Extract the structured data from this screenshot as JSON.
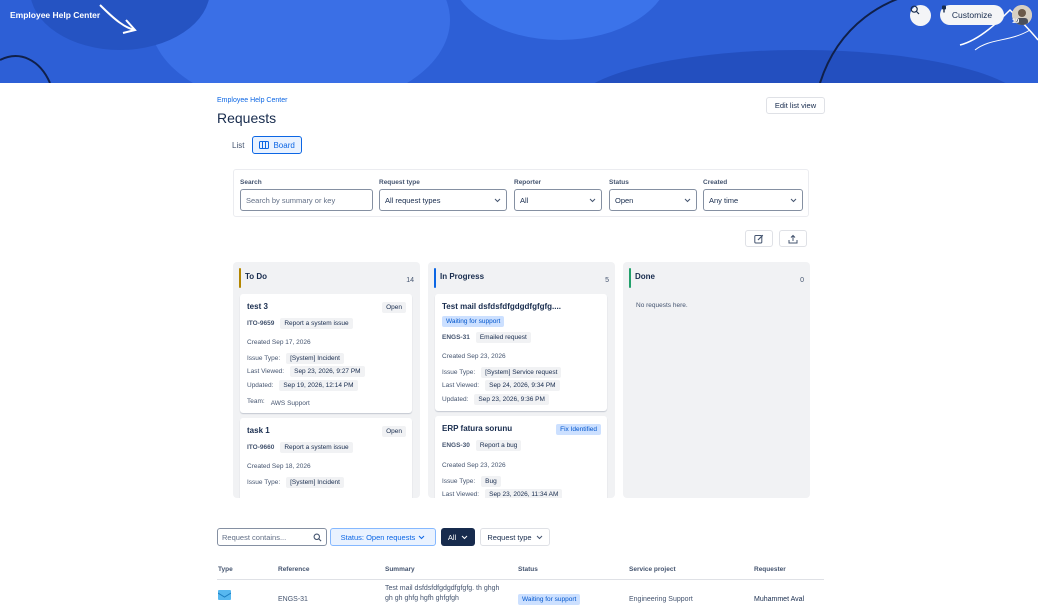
{
  "header": {
    "site_title": "Employee Help Center",
    "customize_label": "Customize",
    "notification_count": "19"
  },
  "breadcrumb": "Employee Help Center",
  "page_title": "Requests",
  "edit_list_label": "Edit list view",
  "view_toggle": {
    "list": "List",
    "board": "Board",
    "active": "board"
  },
  "filters": {
    "search": {
      "label": "Search",
      "placeholder": "Search by summary or key"
    },
    "request_type": {
      "label": "Request type",
      "value": "All request types"
    },
    "reporter": {
      "label": "Reporter",
      "value": "All"
    },
    "status": {
      "label": "Status",
      "value": "Open"
    },
    "created": {
      "label": "Created",
      "value": "Any time"
    }
  },
  "board": {
    "columns": [
      {
        "title": "To Do",
        "count": "14",
        "accent": "#b38600",
        "cards": [
          {
            "title": "test 3",
            "status": "Open",
            "ref": "ITO-9659",
            "type": "Report a system issue",
            "created": "Created Sep 17, 2026",
            "issue_type_label": "Issue Type:",
            "issue_type": "[System] Incident",
            "last_viewed_label": "Last Viewed:",
            "last_viewed": "Sep 23, 2026, 9:27 PM",
            "updated_label": "Updated:",
            "updated": "Sep 19, 2026, 12:14 PM",
            "team_label": "Team:",
            "team": "AWS Support"
          },
          {
            "title": "task 1",
            "status": "Open",
            "ref": "ITO-9660",
            "type": "Report a system issue",
            "created": "Created Sep 18, 2026",
            "issue_type_label": "Issue Type:",
            "issue_type": "[System] Incident"
          }
        ]
      },
      {
        "title": "In Progress",
        "count": "5",
        "accent": "#0c66e4",
        "cards": [
          {
            "title": "Test mail dsfdsfdfgdgdfgfgfg....",
            "status": "Waiting for support",
            "ref": "ENGS-31",
            "type": "Emailed request",
            "created": "Created Sep 23, 2026",
            "issue_type_label": "Issue Type:",
            "issue_type": "[System] Service request",
            "last_viewed_label": "Last Viewed:",
            "last_viewed": "Sep 24, 2026, 9:34 PM",
            "updated_label": "Updated:",
            "updated": "Sep 23, 2026, 9:36 PM"
          },
          {
            "title": "ERP fatura sorunu",
            "status": "Fix Identified",
            "ref": "ENGS-30",
            "type": "Report a bug",
            "created": "Created Sep 23, 2026",
            "issue_type_label": "Issue Type:",
            "issue_type": "Bug",
            "last_viewed_label": "Last Viewed:",
            "last_viewed": "Sep 23, 2026, 11:34 AM"
          }
        ]
      },
      {
        "title": "Done",
        "count": "0",
        "accent": "#22a06b",
        "empty": "No requests here."
      }
    ]
  },
  "bottom_filters": {
    "search_placeholder": "Request contains...",
    "status_pill": "Status: Open requests",
    "all_pill": "All",
    "request_type_pill": "Request type"
  },
  "table": {
    "headers": [
      "Type",
      "Reference",
      "Summary",
      "Status",
      "Service project",
      "Requester"
    ],
    "row": {
      "reference": "ENGS-31",
      "summary": "Test mail dsfdsfdfgdgdfgfgfg. th ghgh gh gh ghfg hgfh ghfgfgh",
      "status": "Waiting for support",
      "project": "Engineering Support",
      "requester": "Muhammet Aval"
    }
  }
}
